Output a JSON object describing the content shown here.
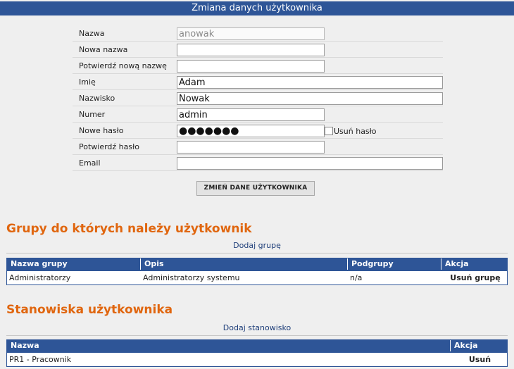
{
  "header": {
    "title": "Zmiana danych użytkownika"
  },
  "form": {
    "fields": [
      {
        "label": "Nazwa",
        "value": "anowak"
      },
      {
        "label": "Nowa nazwa",
        "value": ""
      },
      {
        "label": "Potwierdź nową nazwę",
        "value": ""
      },
      {
        "label": "Imię",
        "value": "Adam"
      },
      {
        "label": "Nazwisko",
        "value": "Nowak"
      },
      {
        "label": "Numer",
        "value": "admin"
      },
      {
        "label": "Nowe hasło",
        "value": "●●●●●●●"
      },
      {
        "label": "Potwierdź hasło",
        "value": ""
      },
      {
        "label": "Email",
        "value": ""
      }
    ],
    "remove_password_label": "Usuń hasło",
    "submit_label": "ZMIEŃ DANE UŻYTKOWNIKA"
  },
  "groups": {
    "title": "Grupy do których należy użytkownik",
    "add_link": "Dodaj grupę",
    "columns": [
      "Nazwa grupy",
      "Opis",
      "Podgrupy",
      "Akcja"
    ],
    "rows": [
      {
        "name": "Administratorzy",
        "description": "Administratorzy systemu",
        "subgroups": "n/a",
        "action": "Usuń grupę"
      }
    ]
  },
  "positions": {
    "title": "Stanowiska użytkownika",
    "add_link": "Dodaj stanowisko",
    "columns": [
      "Nazwa",
      "Akcja"
    ],
    "rows": [
      {
        "name": "PR1 - Pracownik",
        "action": "Usuń"
      }
    ]
  }
}
